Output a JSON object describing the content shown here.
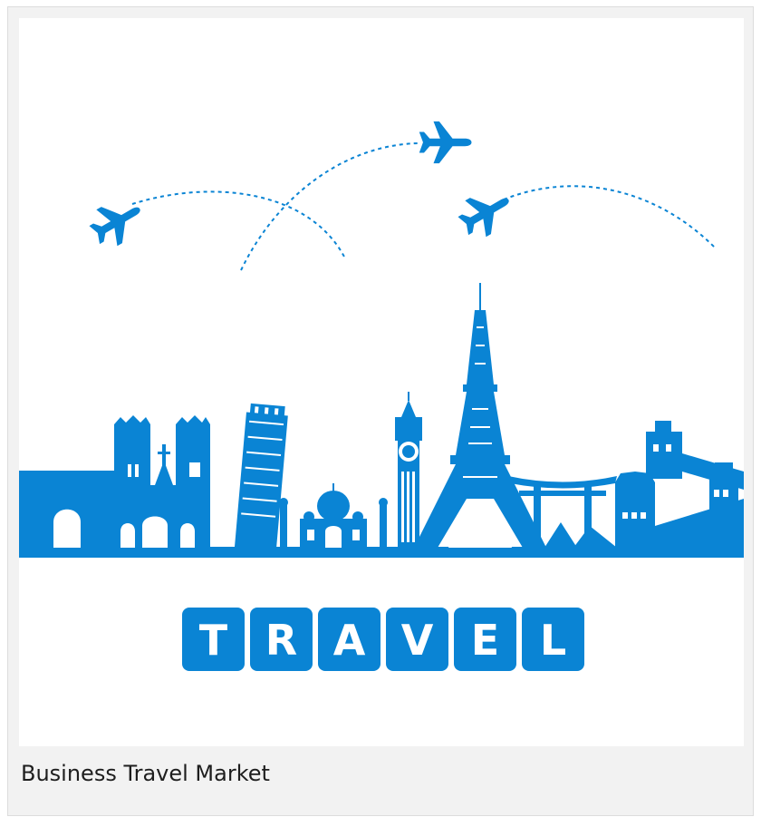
{
  "card": {
    "caption": "Business Travel Market"
  },
  "illustration": {
    "letters": [
      "T",
      "R",
      "A",
      "V",
      "E",
      "L"
    ],
    "accent_color": "#0a84d4",
    "icons": [
      "airplane-icon",
      "eiffel-tower-icon",
      "big-ben-icon",
      "leaning-tower-of-pisa-icon",
      "taj-mahal-icon",
      "notre-dame-icon",
      "arc-de-triomphe-icon",
      "torii-gate-icon",
      "great-wall-icon"
    ]
  }
}
